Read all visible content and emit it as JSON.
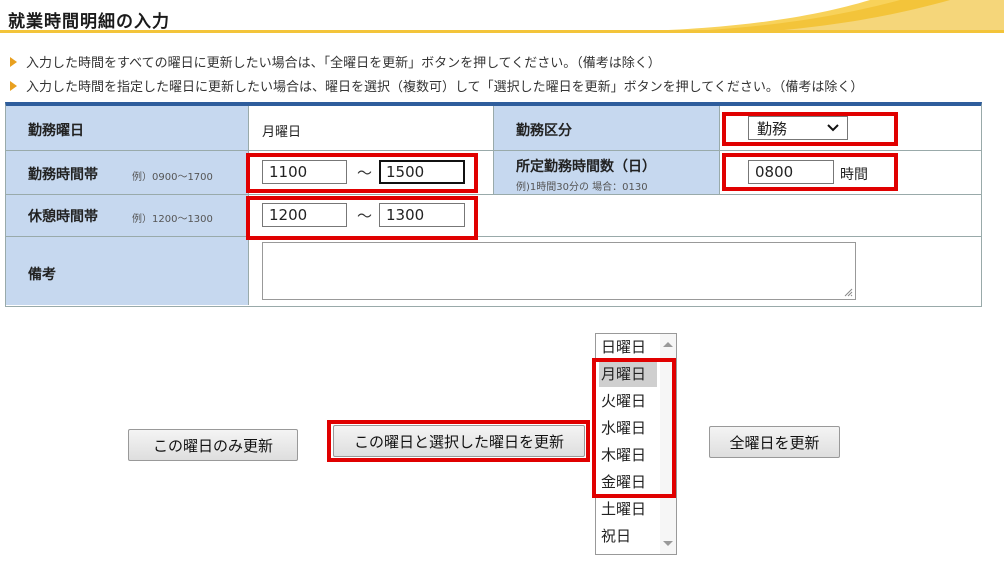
{
  "header": {
    "title": "就業時間明細の入力"
  },
  "info": [
    "入力した時間をすべての曜日に更新したい場合は、「全曜日を更新」ボタンを押してください。（備考は除く）",
    "入力した時間を指定した曜日に更新したい場合は、曜日を選択（複数可）して「選択した曜日を更新」ボタンを押してください。（備考は除く）"
  ],
  "form": {
    "weekday_label": "勤務曜日",
    "weekday_value": "月曜日",
    "work_type_label": "勤務区分",
    "work_type_value": "勤務",
    "work_hours_label": "勤務時間帯",
    "work_hours_example": "例）0900～1700",
    "work_start": "1100",
    "work_end": "1500",
    "tilde": "～",
    "scheduled_label": "所定勤務時間数（日）",
    "scheduled_example": "例)1時間30分の 場合：0130",
    "scheduled_value": "0800",
    "scheduled_unit": "時間",
    "break_label": "休憩時間帯",
    "break_example": "例）1200～1300",
    "break_start": "1200",
    "break_end": "1300",
    "notes_label": "備考",
    "notes_value": ""
  },
  "buttons": {
    "update_this_day": "この曜日のみ更新",
    "update_selected": "この曜日と選択した曜日を更新",
    "update_all": "全曜日を更新"
  },
  "weekdays": {
    "options": [
      "日曜日",
      "月曜日",
      "火曜日",
      "水曜日",
      "木曜日",
      "金曜日",
      "土曜日",
      "祝日"
    ],
    "selected": [
      "月曜日"
    ]
  },
  "colors": {
    "label_bg": "#c6d8ef",
    "table_border_top": "#2e5d9c",
    "highlight_red": "#e00000",
    "accent_yellow": "#f3c43a"
  }
}
